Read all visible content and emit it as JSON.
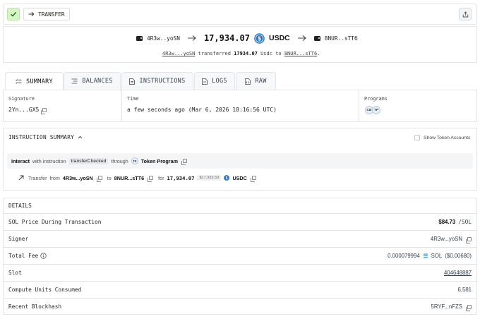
{
  "header": {
    "type_label": "TRANSFER",
    "share_icon": "share-icon"
  },
  "summary": {
    "from_address": "4R3w..yoSN",
    "amount": "17,934.07",
    "token": "USDC",
    "to_address": "8NUR..sTT6",
    "sentence_from": "4R3w...yoSN",
    "sentence_mid": "transferred",
    "sentence_amount": "17934.07",
    "sentence_token": "Usdc to",
    "sentence_to": "8NUR...sTT6",
    "sentence_end": "."
  },
  "tabs": [
    {
      "label": "SUMMARY",
      "icon": "list-icon"
    },
    {
      "label": "BALANCES",
      "icon": "lines-icon"
    },
    {
      "label": "INSTRUCTIONS",
      "icon": "document-icon"
    },
    {
      "label": "LOGS",
      "icon": "file-icon"
    },
    {
      "label": "RAW",
      "icon": "code-file-icon"
    }
  ],
  "meta": {
    "signature_label": "Signature",
    "signature_value": "2Yn...GX5",
    "time_label": "Time",
    "time_value": "a few seconds ago (Mar 6, 2026 18:16:56 UTC)",
    "programs_label": "Programs",
    "program_badges": [
      "CB",
      "TP"
    ]
  },
  "instruction_summary": {
    "title": "INSTRUCTION SUMMARY",
    "toggle_label": "Show Token Accounts",
    "interact_label": "Interact",
    "with_instruction": "with instruction",
    "instruction_name": "transferChecked",
    "through": "through",
    "program_badge": "TP",
    "program_name": "Token Program",
    "transfer_label": "Transfer",
    "from_word": "from",
    "from_addr": "4R3w...yoSN",
    "to_word": "to",
    "to_addr": "8NUR...sTT6",
    "for_word": "for",
    "amount": "17,934.07",
    "usd_value": "$17,933.53",
    "token": "USDC"
  },
  "details": {
    "title": "DETAILS",
    "rows": [
      {
        "label": "SOL Price During Transaction",
        "value": "$84.73",
        "suffix": "/SOL"
      },
      {
        "label": "Signer",
        "value": "4R3w...yoSN"
      },
      {
        "label": "Total Fee",
        "value": "0.000079994",
        "unit": "SOL",
        "usd": "($0.00680)"
      },
      {
        "label": "Slot",
        "value": "404648887"
      },
      {
        "label": "Compute Units Consumed",
        "value": "6,581"
      },
      {
        "label": "Recent Blockhash",
        "value": "5RYF...nFZS"
      }
    ]
  },
  "colors": {
    "accent_green": "#d6f5c7",
    "usdc_blue": "#2775ca",
    "border": "#e3e5e8"
  }
}
